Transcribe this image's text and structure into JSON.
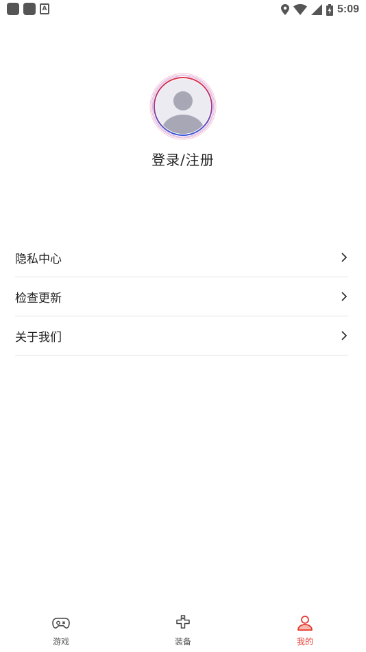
{
  "status_bar": {
    "time": "5:09",
    "notification_letter": "A"
  },
  "profile": {
    "login_label": "登录/注册"
  },
  "menu": {
    "items": [
      {
        "label": "隐私中心"
      },
      {
        "label": "检查更新"
      },
      {
        "label": "关于我们"
      }
    ]
  },
  "bottom_nav": {
    "active_color": "#e5392f",
    "items": [
      {
        "label": "游戏",
        "icon": "gamepad-icon"
      },
      {
        "label": "装备",
        "icon": "dpad-icon"
      },
      {
        "label": "我的",
        "icon": "person-icon"
      }
    ]
  }
}
